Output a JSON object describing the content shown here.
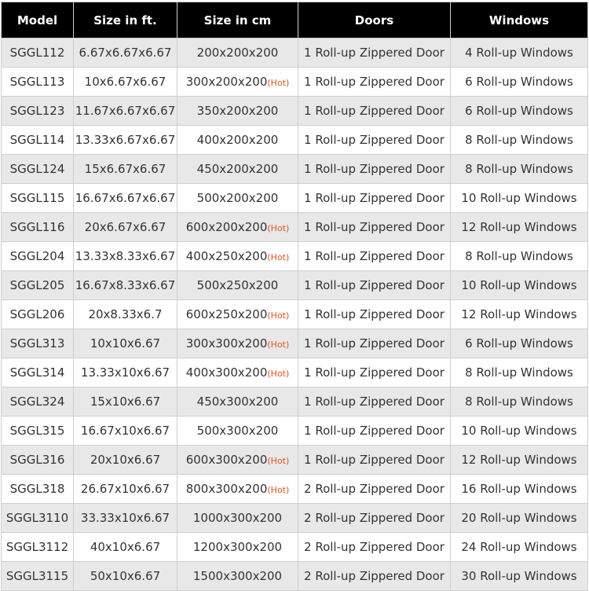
{
  "headers": [
    "Model",
    "Size in ft.",
    "Size in cm",
    "Doors",
    "Windows"
  ],
  "hot_label": "(Hot)",
  "colors": {
    "header_bg": "#000000",
    "row_alt": "#e8e8e8",
    "hot": "#e0541e"
  },
  "rows": [
    {
      "model": "SGGL112",
      "ft": "6.67x6.67x6.67",
      "cm": "200x200x200",
      "hot": false,
      "doors": "1 Roll-up Zippered Door",
      "windows": "4 Roll-up Windows"
    },
    {
      "model": "SGGL113",
      "ft": "10x6.67x6.67",
      "cm": "300x200x200",
      "hot": true,
      "doors": "1 Roll-up Zippered Door",
      "windows": "6 Roll-up Windows"
    },
    {
      "model": "SGGL123",
      "ft": "11.67x6.67x6.67",
      "cm": "350x200x200",
      "hot": false,
      "doors": "1 Roll-up Zippered Door",
      "windows": "6 Roll-up Windows"
    },
    {
      "model": "SGGL114",
      "ft": "13.33x6.67x6.67",
      "cm": "400x200x200",
      "hot": false,
      "doors": "1 Roll-up Zippered Door",
      "windows": "8 Roll-up Windows"
    },
    {
      "model": "SGGL124",
      "ft": "15x6.67x6.67",
      "cm": "450x200x200",
      "hot": false,
      "doors": "1 Roll-up Zippered Door",
      "windows": "8 Roll-up Windows"
    },
    {
      "model": "SGGL115",
      "ft": "16.67x6.67x6.67",
      "cm": "500x200x200",
      "hot": false,
      "doors": "1 Roll-up Zippered Door",
      "windows": "10 Roll-up Windows"
    },
    {
      "model": "SGGL116",
      "ft": "20x6.67x6.67",
      "cm": "600x200x200",
      "hot": true,
      "doors": "1 Roll-up Zippered Door",
      "windows": "12 Roll-up Windows"
    },
    {
      "model": "SGGL204",
      "ft": "13.33x8.33x6.67",
      "cm": "400x250x200",
      "hot": true,
      "doors": "1 Roll-up Zippered Door",
      "windows": "8 Roll-up Windows"
    },
    {
      "model": "SGGL205",
      "ft": "16.67x8.33x6.67",
      "cm": "500x250x200",
      "hot": false,
      "doors": "1 Roll-up Zippered Door",
      "windows": "10 Roll-up Windows"
    },
    {
      "model": "SGGL206",
      "ft": "20x8.33x6.7",
      "cm": "600x250x200",
      "hot": true,
      "doors": "1 Roll-up Zippered Door",
      "windows": "12 Roll-up Windows"
    },
    {
      "model": "SGGL313",
      "ft": "10x10x6.67",
      "cm": "300x300x200",
      "hot": true,
      "doors": "1 Roll-up Zippered Door",
      "windows": "6 Roll-up Windows"
    },
    {
      "model": "SGGL314",
      "ft": "13.33x10x6.67",
      "cm": "400x300x200",
      "hot": true,
      "doors": "1 Roll-up Zippered Door",
      "windows": "8 Roll-up Windows"
    },
    {
      "model": "SGGL324",
      "ft": "15x10x6.67",
      "cm": "450x300x200",
      "hot": false,
      "doors": "1 Roll-up Zippered Door",
      "windows": "8 Roll-up Windows"
    },
    {
      "model": "SGGL315",
      "ft": "16.67x10x6.67",
      "cm": "500x300x200",
      "hot": false,
      "doors": "1 Roll-up Zippered Door",
      "windows": "10 Roll-up Windows"
    },
    {
      "model": "SGGL316",
      "ft": "20x10x6.67",
      "cm": "600x300x200",
      "hot": true,
      "doors": "1 Roll-up Zippered Door",
      "windows": "12 Roll-up Windows"
    },
    {
      "model": "SGGL318",
      "ft": "26.67x10x6.67",
      "cm": "800x300x200",
      "hot": true,
      "doors": "2 Roll-up Zippered Door",
      "windows": "16 Roll-up Windows"
    },
    {
      "model": "SGGL3110",
      "ft": "33.33x10x6.67",
      "cm": "1000x300x200",
      "hot": false,
      "doors": "2 Roll-up Zippered Door",
      "windows": "20 Roll-up Windows"
    },
    {
      "model": "SGGL3112",
      "ft": "40x10x6.67",
      "cm": "1200x300x200",
      "hot": false,
      "doors": "2 Roll-up Zippered Door",
      "windows": "24 Roll-up Windows"
    },
    {
      "model": "SGGL3115",
      "ft": "50x10x6.67",
      "cm": "1500x300x200",
      "hot": false,
      "doors": "2 Roll-up Zippered Door",
      "windows": "30 Roll-up Windows"
    }
  ]
}
